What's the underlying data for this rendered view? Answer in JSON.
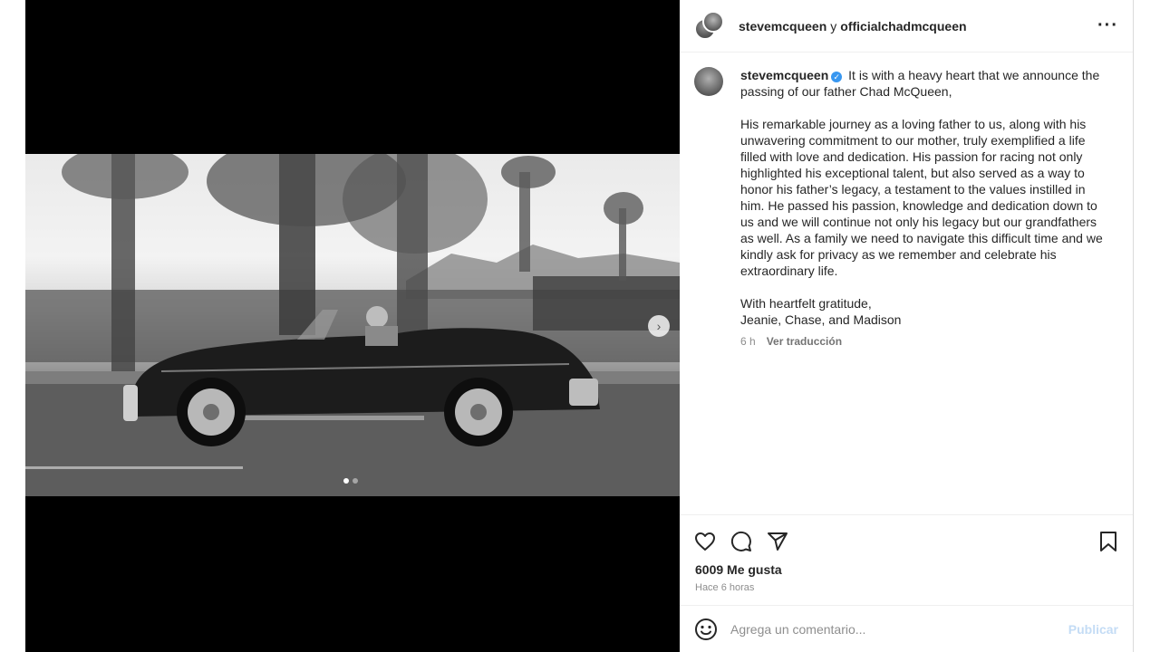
{
  "header": {
    "user1": "stevemcqueen",
    "conjunction": "y",
    "user2": "officialchadmcqueen",
    "more_icon": "more-icon"
  },
  "caption": {
    "username": "stevemcqueen",
    "verified": true,
    "paragraph1": "It is with a heavy heart that we announce the passing of our father Chad McQueen,",
    "paragraph2": "His remarkable journey as a loving father to us, along with his unwavering commitment to our mother, truly exemplified a life filled with love and dedication. His passion for racing not only highlighted his exceptional talent, but also served as a way to honor his father’s legacy, a testament to the values instilled in him. He passed his passion, knowledge and dedication down to us and we will continue not only his legacy but our grandfathers as well. As a family we need to navigate this difficult time and we kindly ask for privacy as we remember and celebrate his extraordinary life.",
    "signoff1": "With heartfelt gratitude,",
    "signoff2": "Jeanie, Chase, and Madison",
    "age": "6 h",
    "translate": "Ver traducción"
  },
  "media": {
    "slide_count": 2,
    "active_slide": 1,
    "next_icon": "chevron-right-icon"
  },
  "actions": {
    "icons": [
      "heart-icon",
      "comment-icon",
      "share-icon",
      "bookmark-icon"
    ]
  },
  "stats": {
    "likes": "6009 Me gusta",
    "time": "Hace 6 horas"
  },
  "comment": {
    "placeholder": "Agrega un comentario...",
    "publish": "Publicar",
    "emoji_icon": "emoji-icon"
  },
  "colors": {
    "verified": "#3897f0",
    "publish_disabled": "#c4dcf5",
    "muted_text": "#8e8e8e"
  }
}
